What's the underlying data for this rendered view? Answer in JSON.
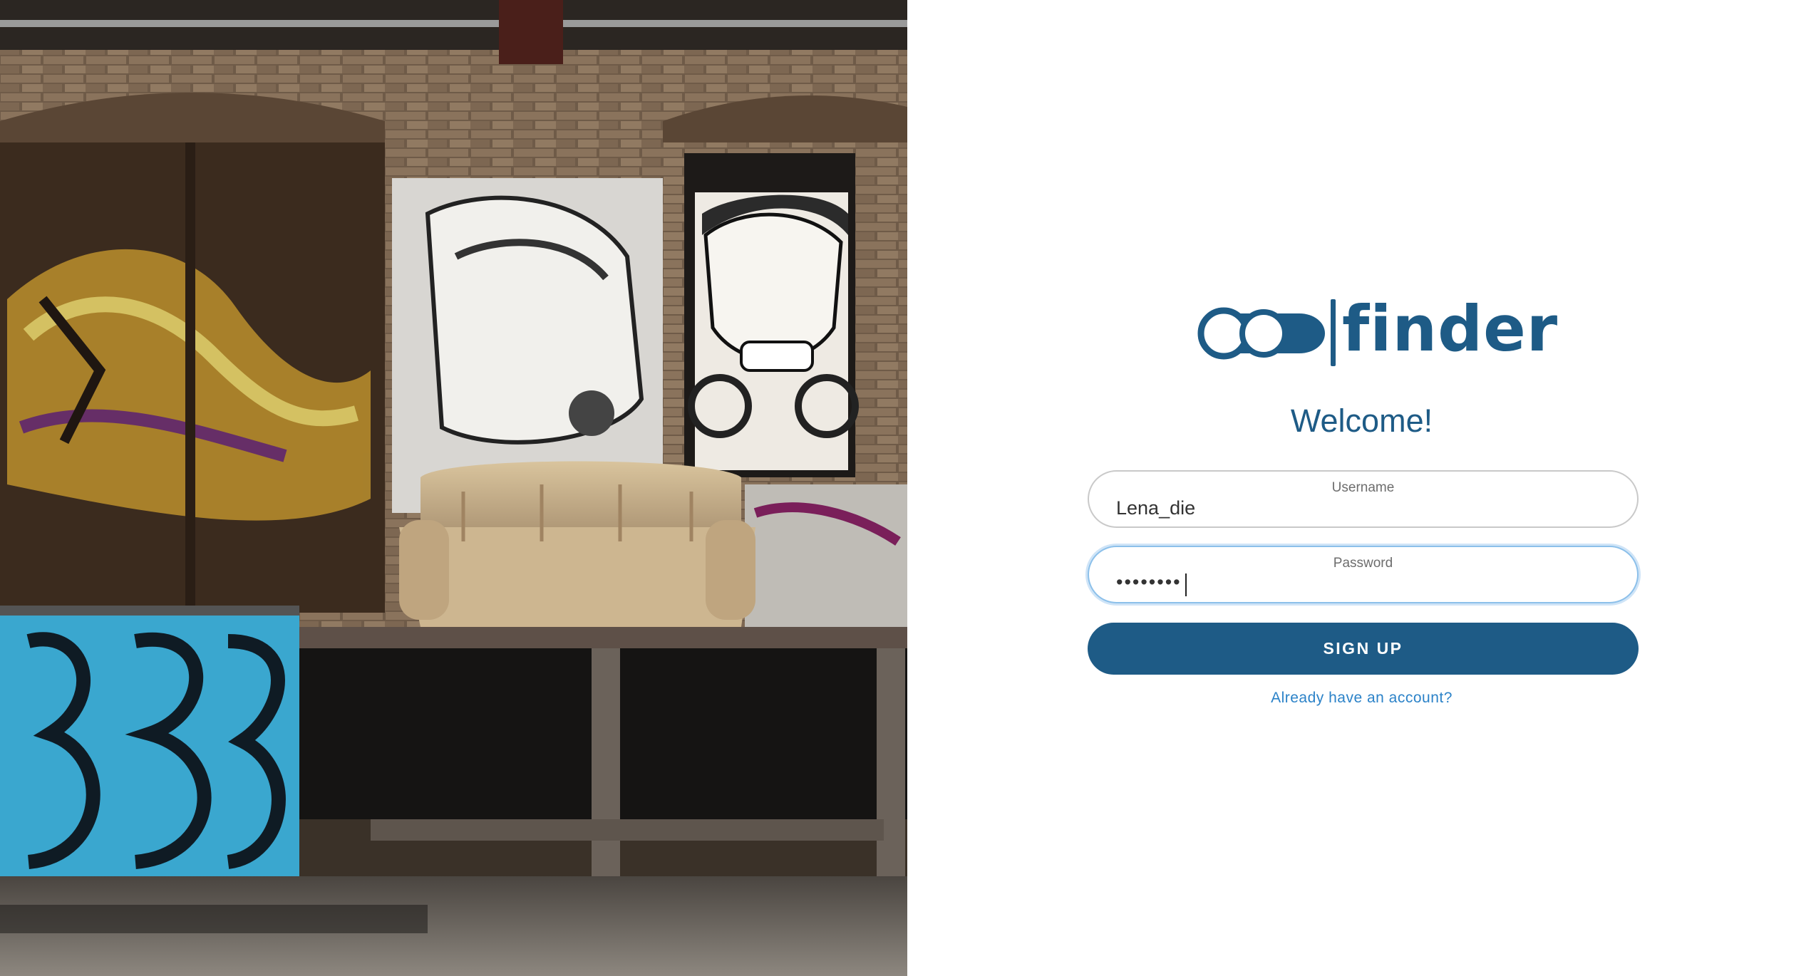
{
  "hero_image": {
    "semantic": "graffiti-wall-with-beige-sofa-photo"
  },
  "logo": {
    "word": "finder",
    "icon": "binoculars-icon",
    "brand_color": "#1e5b86"
  },
  "welcome": "Welcome!",
  "form": {
    "username": {
      "label": "Username",
      "value": "Lena_die"
    },
    "password": {
      "label": "Password",
      "value": "••••••••"
    },
    "submit_label": "SIGN UP",
    "login_link": "Already have an account?"
  },
  "colors": {
    "accent": "#1e5b86",
    "link": "#2b82c8",
    "focus_ring": "#8cc0ea"
  }
}
